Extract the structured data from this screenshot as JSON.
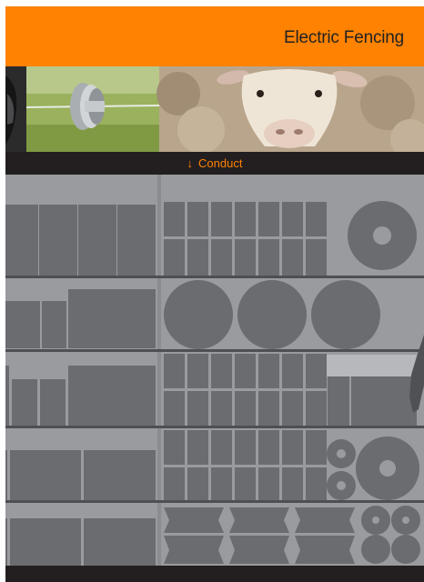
{
  "header": {
    "title": "Electric Fencing"
  },
  "hero": {
    "images": [
      "sheep-ear-photo",
      "fence-insulator-photo",
      "sheep-face-photo"
    ]
  },
  "category_nav": {
    "link_label": "Conduct",
    "arrow_icon": "arrow-down-icon"
  },
  "colors": {
    "brand_orange": "#ff8200",
    "dark_bar": "#231f20",
    "shelf_bg": "#9a9b9e",
    "product_gray": "#6b6c6f"
  }
}
